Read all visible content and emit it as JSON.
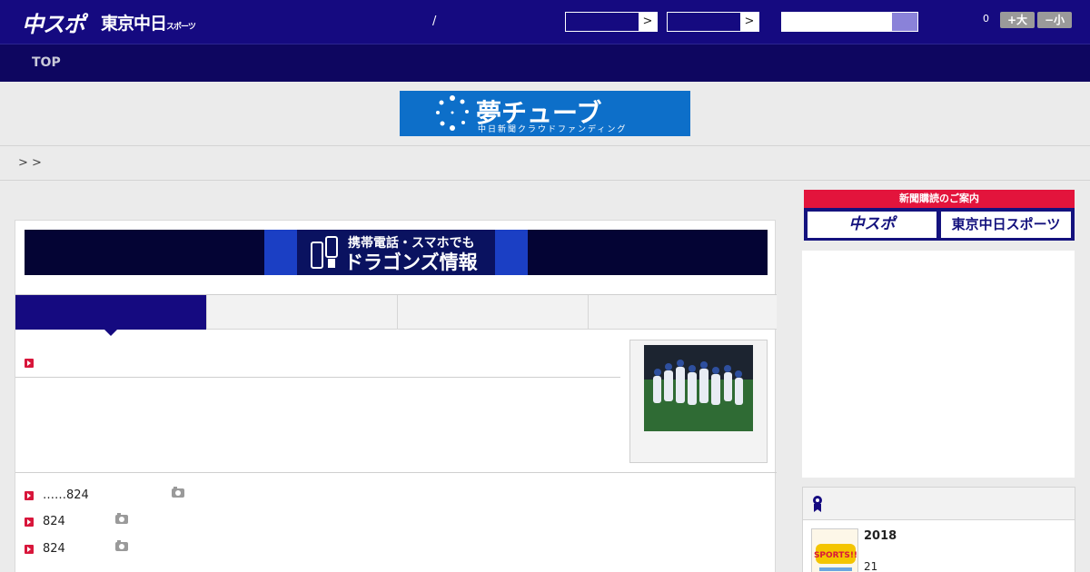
{
  "header": {
    "logo_primary": "中スポ",
    "logo_secondary": "東京中日",
    "logo_secondary_suffix": "スポーツ",
    "separator": "/",
    "select1_arrow": ">",
    "select2_arrow": ">",
    "search_placeholder": "",
    "count": "0",
    "font_larger": "+大",
    "font_smaller": "−小"
  },
  "nav": {
    "top_label": "TOP"
  },
  "dream_banner": {
    "title": "夢チューブ",
    "subtitle": "中日新聞クラウドファンディング"
  },
  "breadcrumb": "> >",
  "mobile_banner": {
    "line1": "携帯電話・スマホでも",
    "line2": "ドラゴンズ情報"
  },
  "news_list": [
    {
      "text": "……824",
      "has_photo": true
    },
    {
      "text": "824",
      "has_photo": true
    },
    {
      "text": "824",
      "has_photo": true
    }
  ],
  "subscription_ad": {
    "header": "新聞購読のご案内",
    "left_label": "中スポ",
    "right_label": "東京中日スポーツ"
  },
  "ranking": {
    "title": "2018",
    "number": "21",
    "thumb_text": "SPORTS!!"
  },
  "colors": {
    "header_bg": "#150a80",
    "nav_bg": "#0e0660",
    "accent_red": "#d8163b",
    "search_btn": "#8a82d9"
  }
}
